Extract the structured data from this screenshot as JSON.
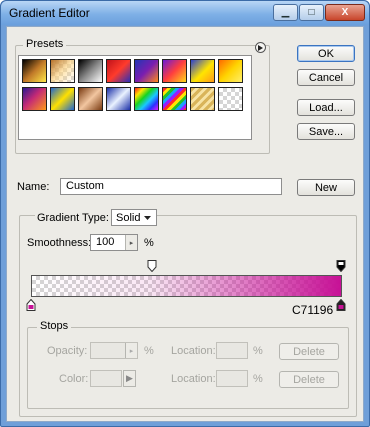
{
  "window": {
    "title": "Gradient Editor"
  },
  "controls": {
    "minimize_icon": "minimize-icon",
    "maximize_icon": "maximize-icon",
    "close_label": "X"
  },
  "presets": {
    "label": "Presets",
    "menu_icon": "flyout-menu-icon",
    "swatches": [
      [
        "#000000",
        "#b5712a",
        "#ffd100",
        "#fff06a",
        "#b61214",
        "#1e3bb0",
        "#6a1ad6",
        "#ffe100"
      ],
      [
        "#5b1fb0",
        "#1f67cf",
        "#b5712a",
        "#2a3fc1",
        "#ff1a1a",
        "#e6c35a",
        "#d5d5d5",
        "#d5d5d5"
      ]
    ]
  },
  "buttons": {
    "ok": "OK",
    "cancel": "Cancel",
    "load": "Load...",
    "save": "Save...",
    "new": "New",
    "delete1": "Delete",
    "delete2": "Delete"
  },
  "name": {
    "label": "Name:",
    "value": "Custom"
  },
  "gradient": {
    "type_label": "Gradient Type:",
    "type_value": "Solid",
    "smoothness_label": "Smoothness:",
    "smoothness_value": "100",
    "smoothness_unit": "%",
    "end_color_hex": "C71196",
    "end_color": "#c71196"
  },
  "stops": {
    "label": "Stops",
    "opacity_label": "Opacity:",
    "opacity_unit": "%",
    "location_label1": "Location:",
    "location_unit1": "%",
    "color_label": "Color:",
    "location_label2": "Location:",
    "location_unit2": "%"
  }
}
